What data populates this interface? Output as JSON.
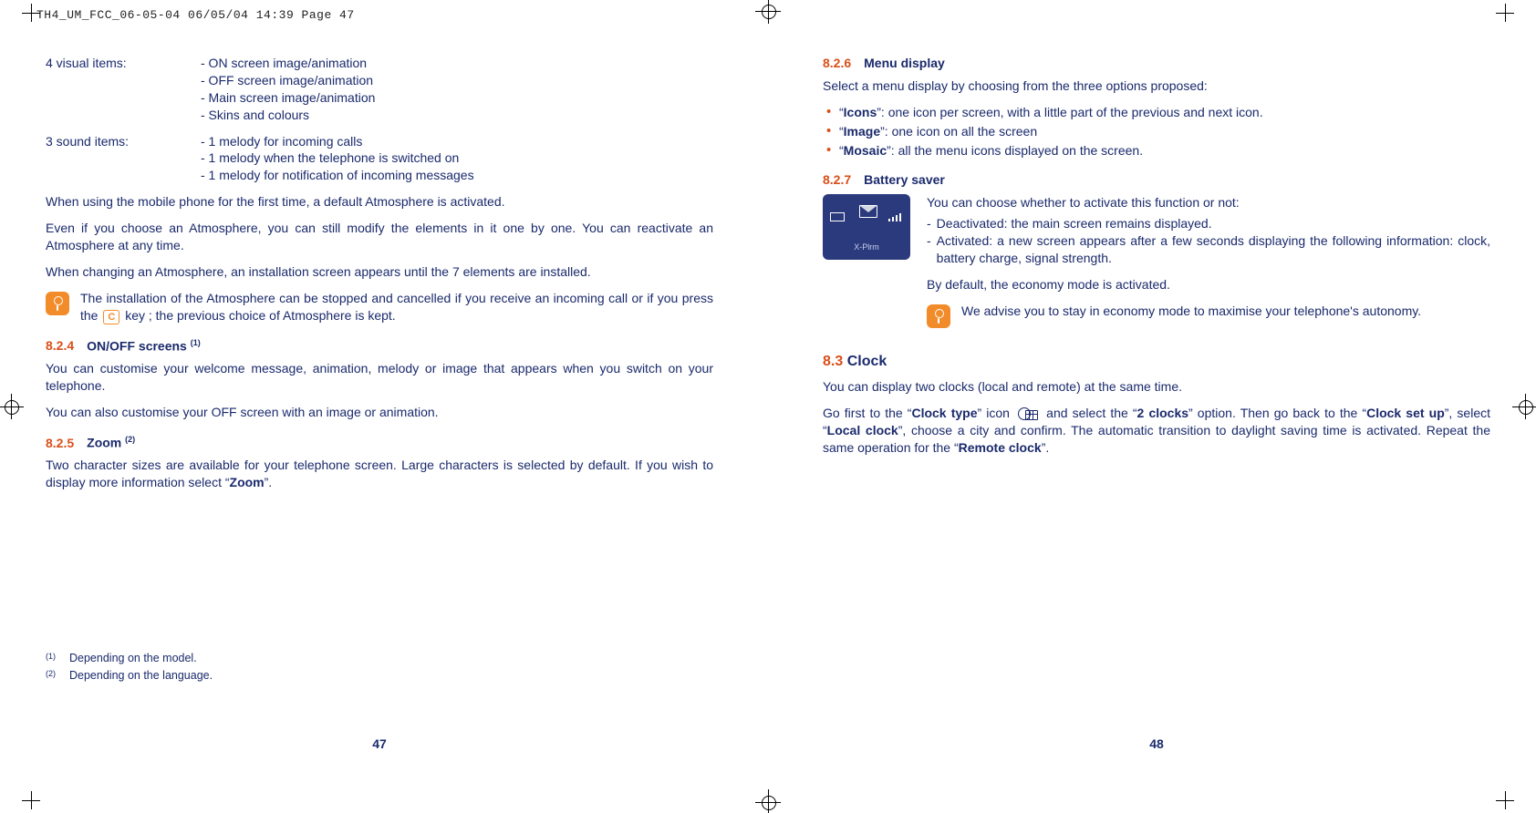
{
  "slug": "TH4_UM_FCC_06-05-04  06/05/04  14:39  Page 47",
  "left": {
    "visual_label": "4 visual items:",
    "visual_items": [
      "- ON screen image/animation",
      "- OFF screen image/animation",
      "- Main screen image/animation",
      "- Skins and colours"
    ],
    "sound_label": "3 sound items:",
    "sound_items": [
      "- 1 melody for incoming calls",
      "- 1 melody when the telephone is switched on",
      "- 1 melody for notification of incoming messages"
    ],
    "p1": "When using the mobile phone for the first time, a default Atmosphere is activated.",
    "p2": "Even if you choose an Atmosphere, you can still modify the elements in it one by one. You can reactivate an Atmosphere at any time.",
    "p3": "When changing an Atmosphere, an installation screen appears until the 7 elements are installed.",
    "tip_a": "The installation of the Atmosphere can be stopped and cancelled if you receive an incoming call or if you press the ",
    "tip_key": "C",
    "tip_b": " key ; the previous choice of Atmosphere is kept.",
    "h824_num": "8.2.4",
    "h824_title": "ON/OFF screens ",
    "h824_sup": "(1)",
    "p824a": "You can customise your welcome message, animation, melody or image that appears when you switch on your telephone.",
    "p824b": "You can also customise your OFF screen with an image or animation.",
    "h825_num": "8.2.5",
    "h825_title": "Zoom ",
    "h825_sup": "(2)",
    "p825a_pre": "Two character sizes are available for your telephone screen. Large characters is selected by default. If you wish to display more information select “",
    "p825a_bold": "Zoom",
    "p825a_post": "”.",
    "fn1_sup": "(1)",
    "fn1": "Depending on the model.",
    "fn2_sup": "(2)",
    "fn2": "Depending on the language.",
    "pagenum": "47"
  },
  "right": {
    "h826_num": "8.2.6",
    "h826_title": "Menu display",
    "p826_intro": "Select a menu display by choosing from the three options proposed:",
    "b826_1_b": "Icons",
    "b826_1_t": "”: one icon per screen, with a little part of the previous and next icon.",
    "b826_2_b": "Image",
    "b826_2_t": "”: one icon on all the screen",
    "b826_3_b": "Mosaic",
    "b826_3_t": "”: all the menu icons displayed on the screen.",
    "h827_num": "8.2.7",
    "h827_title": "Battery saver",
    "saver_intro": "You can choose whether to activate this function or not:",
    "saver_d1": "Deactivated: the main screen remains displayed.",
    "saver_d2": "Activated: a new screen appears after a few seconds displaying the following information: clock, battery charge, signal strength.",
    "saver_default": "By default, the economy mode is activated.",
    "saver_tip": "We advise you to stay in economy mode to maximise your telephone's autonomy.",
    "thumb_label": "X-Plrm",
    "h83_num": "8.3",
    "h83_title": "Clock",
    "p83a": "You can display two clocks (local and remote) at the same time.",
    "p83b_1": "Go first to the “",
    "p83b_2": "Clock type",
    "p83b_3": "” icon ",
    "p83b_4": " and select the “",
    "p83b_5": "2 clocks",
    "p83b_6": "” option. Then go back to the “",
    "p83b_7": "Clock set up",
    "p83b_8": "”, select “",
    "p83b_9": "Local clock",
    "p83b_10": "”, choose a city and confirm. The automatic transition to daylight saving time is activated. Repeat the same operation for the “",
    "p83b_11": "Remote clock",
    "p83b_12": "”.",
    "pagenum": "48"
  }
}
